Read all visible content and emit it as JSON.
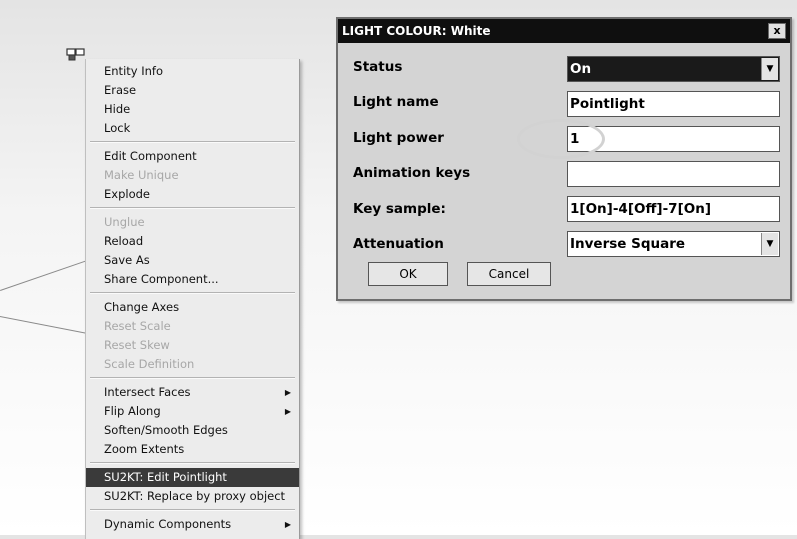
{
  "context_menu": {
    "groups": [
      [
        {
          "label": "Entity Info",
          "disabled": false
        },
        {
          "label": "Erase",
          "disabled": false
        },
        {
          "label": "Hide",
          "disabled": false
        },
        {
          "label": "Lock",
          "disabled": false
        }
      ],
      [
        {
          "label": "Edit Component",
          "disabled": false
        },
        {
          "label": "Make Unique",
          "disabled": true
        },
        {
          "label": "Explode",
          "disabled": false
        }
      ],
      [
        {
          "label": "Unglue",
          "disabled": true
        },
        {
          "label": "Reload",
          "disabled": false
        },
        {
          "label": "Save As",
          "disabled": false
        },
        {
          "label": "Share Component...",
          "disabled": false
        }
      ],
      [
        {
          "label": "Change Axes",
          "disabled": false
        },
        {
          "label": "Reset Scale",
          "disabled": true
        },
        {
          "label": "Reset Skew",
          "disabled": true
        },
        {
          "label": "Scale Definition",
          "disabled": true
        }
      ],
      [
        {
          "label": "Intersect Faces",
          "disabled": false,
          "submenu": true
        },
        {
          "label": "Flip Along",
          "disabled": false,
          "submenu": true
        },
        {
          "label": "Soften/Smooth Edges",
          "disabled": false
        },
        {
          "label": "Zoom Extents",
          "disabled": false
        }
      ],
      [
        {
          "label": "SU2KT: Edit Pointlight",
          "disabled": false,
          "selected": true
        },
        {
          "label": "SU2KT: Replace by proxy object",
          "disabled": false
        }
      ],
      [
        {
          "label": "Dynamic Components",
          "disabled": false,
          "submenu": true
        }
      ]
    ]
  },
  "dialog": {
    "title": "LIGHT COLOUR: White",
    "close_label": "x",
    "status_label": "Status",
    "status_value": "On",
    "light_name_label": "Light name",
    "light_name_value": "Pointlight",
    "light_power_label": "Light power",
    "light_power_value": "1",
    "animation_keys_label": "Animation keys",
    "animation_keys_value": "",
    "key_sample_label": "Key sample:",
    "key_sample_value": "1[On]-4[Off]-7[On]",
    "attenuation_label": "Attenuation",
    "attenuation_value": "Inverse Square",
    "ok_label": "OK",
    "cancel_label": "Cancel"
  },
  "icons": {
    "component": "component-icon",
    "dropdown": "dropdown-arrow-icon",
    "submenu": "submenu-arrow-icon"
  }
}
